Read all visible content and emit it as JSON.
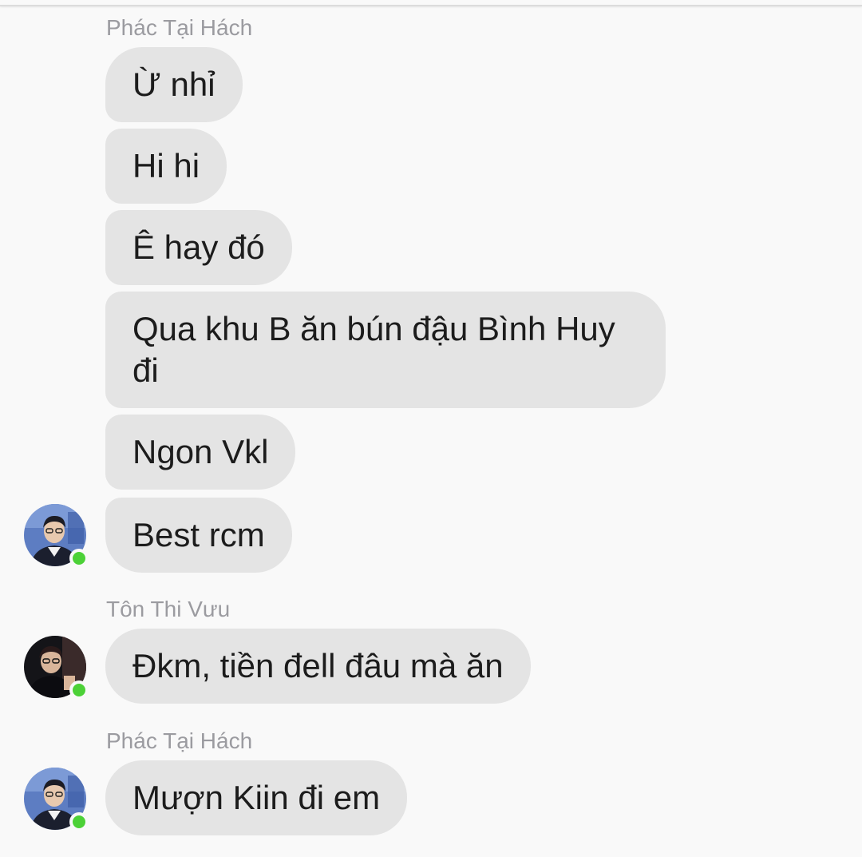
{
  "groups": [
    {
      "sender": "Phác Tại Hách",
      "messages": [
        "Ừ nhỉ",
        "Hi hi",
        "Ê hay đó",
        "Qua khu B ăn bún đậu Bình Huy đi",
        "Ngon Vkl",
        "Best rcm"
      ]
    },
    {
      "sender": "Tôn Thi Vưu",
      "messages": [
        "Đkm, tiền đell đâu mà ăn"
      ]
    },
    {
      "sender": "Phác Tại Hách",
      "messages": [
        "Mượn Kiin đi em"
      ]
    }
  ],
  "colors": {
    "background": "#f9f9f9",
    "bubble": "#e4e4e4",
    "sender_name": "#9b9ba0",
    "online_dot": "#4cd137"
  },
  "icons": {
    "avatar_1": "user-avatar-photo",
    "avatar_2": "user-avatar-photo",
    "online": "online-status-dot"
  }
}
